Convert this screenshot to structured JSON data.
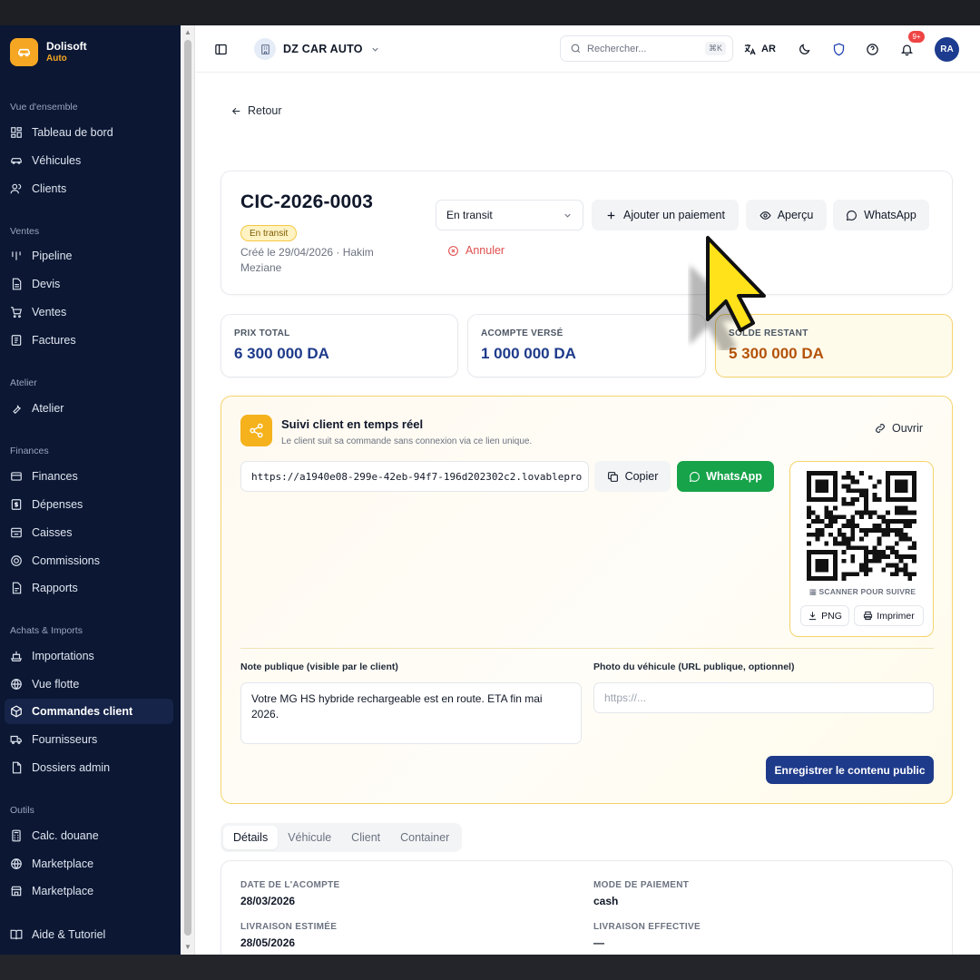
{
  "brand": {
    "name": "Dolisoft",
    "sub": "Auto"
  },
  "sidebar": {
    "sections": [
      {
        "title": "Vue d'ensemble",
        "items": [
          {
            "label": "Tableau de bord",
            "icon": "dashboard-icon"
          },
          {
            "label": "Véhicules",
            "icon": "car-icon"
          },
          {
            "label": "Clients",
            "icon": "users-icon"
          }
        ]
      },
      {
        "title": "Ventes",
        "items": [
          {
            "label": "Pipeline",
            "icon": "pipeline-icon"
          },
          {
            "label": "Devis",
            "icon": "file-icon"
          },
          {
            "label": "Ventes",
            "icon": "cart-icon"
          },
          {
            "label": "Factures",
            "icon": "receipt-icon"
          }
        ]
      },
      {
        "title": "Atelier",
        "items": [
          {
            "label": "Atelier",
            "icon": "wrench-icon"
          }
        ]
      },
      {
        "title": "Finances",
        "items": [
          {
            "label": "Finances",
            "icon": "wallet-icon"
          },
          {
            "label": "Dépenses",
            "icon": "dollar-icon"
          },
          {
            "label": "Caisses",
            "icon": "cashbox-icon"
          },
          {
            "label": "Commissions",
            "icon": "percent-icon"
          },
          {
            "label": "Rapports",
            "icon": "report-icon"
          }
        ]
      },
      {
        "title": "Achats & Imports",
        "items": [
          {
            "label": "Importations",
            "icon": "ship-icon"
          },
          {
            "label": "Vue flotte",
            "icon": "globe-icon"
          },
          {
            "label": "Commandes client",
            "icon": "package-icon"
          },
          {
            "label": "Fournisseurs",
            "icon": "truck-icon"
          },
          {
            "label": "Dossiers admin",
            "icon": "folder-icon"
          }
        ]
      },
      {
        "title": "Outils",
        "items": [
          {
            "label": "Calc. douane",
            "icon": "calculator-icon"
          },
          {
            "label": "Marketplace",
            "icon": "globe-icon"
          },
          {
            "label": "Marketplace",
            "icon": "store-icon"
          }
        ]
      }
    ],
    "footer_item": {
      "label": "Aide & Tutoriel",
      "icon": "book-icon"
    }
  },
  "header": {
    "company": "DZ CAR AUTO",
    "search_placeholder": "Rechercher...",
    "search_shortcut": "⌘K",
    "language": "AR",
    "notification_count": "9+",
    "avatar_initials": "RA"
  },
  "page": {
    "back_label": "Retour",
    "order": {
      "reference": "CIC-2026-0003",
      "status_badge": "En transit",
      "created": "Créé le 29/04/2026 · Hakim Meziane",
      "status_select": "En transit",
      "add_payment": "Ajouter un paiement",
      "preview": "Aperçu",
      "whatsapp": "WhatsApp",
      "cancel": "Annuler"
    },
    "stats": [
      {
        "label": "PRIX TOTAL",
        "value": "6 300 000 DA"
      },
      {
        "label": "ACOMPTE VERSÉ",
        "value": "1 000 000 DA"
      },
      {
        "label": "SOLDE RESTANT",
        "value": "5 300 000 DA"
      }
    ],
    "tracking": {
      "title": "Suivi client en temps réel",
      "subtitle": "Le client suit sa commande sans connexion via ce lien unique.",
      "open": "Ouvrir",
      "url": "https://a1940e08-299e-42eb-94f7-196d202302c2.lovablepro",
      "copy": "Copier",
      "whatsapp": "WhatsApp",
      "qr_caption": "SCANNER POUR SUIVRE",
      "png": "PNG",
      "print": "Imprimer",
      "note_label": "Note publique (visible par le client)",
      "note_value": "Votre MG HS hybride rechargeable est en route. ETA fin mai 2026.",
      "photo_label": "Photo du véhicule (URL publique, optionnel)",
      "photo_placeholder": "https://...",
      "save": "Enregistrer le contenu public"
    },
    "tabs": [
      "Détails",
      "Véhicule",
      "Client",
      "Container"
    ],
    "details": [
      {
        "label": "DATE DE L'ACOMPTE",
        "value": "28/03/2026"
      },
      {
        "label": "MODE DE PAIEMENT",
        "value": "cash"
      },
      {
        "label": "LIVRAISON ESTIMÉE",
        "value": "28/05/2026"
      },
      {
        "label": "LIVRAISON EFFECTIVE",
        "value": "—"
      }
    ]
  },
  "colors": {
    "sidebar_bg": "#0b1733",
    "accent": "#f5a623",
    "primary": "#1e3a8a",
    "whatsapp": "#16a34a",
    "danger": "#e04f4f",
    "balance": "#b45309"
  }
}
